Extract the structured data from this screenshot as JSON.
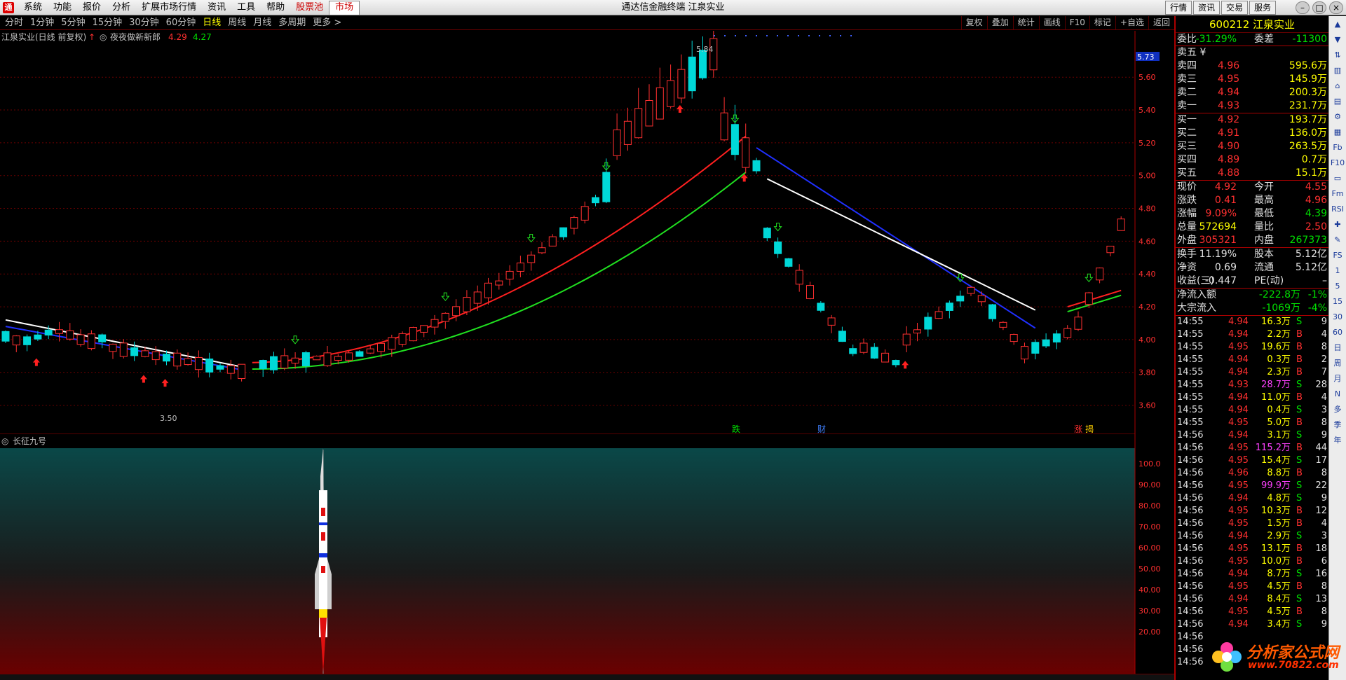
{
  "menubar": {
    "items": [
      "系统",
      "功能",
      "报价",
      "分析",
      "扩展市场行情",
      "资讯",
      "工具",
      "帮助"
    ],
    "stock_pool": "股票池",
    "market": "市场",
    "title": "通达信金融终端 江泉实业",
    "right_buttons": [
      "行情",
      "资讯",
      "交易",
      "服务"
    ]
  },
  "periods": {
    "items": [
      "分时",
      "1分钟",
      "5分钟",
      "15分钟",
      "30分钟",
      "60分钟",
      "日线",
      "周线",
      "月线",
      "多周期",
      "更多 >"
    ],
    "selected": "日线"
  },
  "chart_buttons": [
    "复权",
    "叠加",
    "统计",
    "画线",
    "F10",
    "标记",
    "+自选",
    "返回"
  ],
  "chart": {
    "title": "江泉实业(日线 前复权)",
    "indicator_name": "夜夜做新新郎",
    "ind_val1": "4.29",
    "ind_val2": "4.27",
    "y_labels": [
      "5.73",
      "5.60",
      "5.40",
      "5.20",
      "5.00",
      "4.80",
      "4.60",
      "4.40",
      "4.20",
      "4.00",
      "3.80",
      "3.60"
    ],
    "current_price_tag": "5.73",
    "high_label": "5.84",
    "low_label": "3.50",
    "events": [
      "跌",
      "财",
      "涨",
      "揭"
    ],
    "colors": {
      "up": "#ff3030",
      "down": "#00d8d8",
      "ma_red": "#ff2020",
      "ma_green": "#20e020",
      "ma_white": "#ffffff",
      "ma_blue": "#2030ff",
      "grid": "#6a0000"
    }
  },
  "subchart": {
    "title": "长征九号",
    "y_labels": [
      "100.0",
      "90.00",
      "80.00",
      "70.00",
      "60.00",
      "50.00",
      "40.00",
      "30.00",
      "20.00"
    ]
  },
  "quote": {
    "code_name": "600212 江泉实业",
    "weibi_label": "委比",
    "weibi": "-31.29%",
    "weicha_label": "委差",
    "weicha": "-11300",
    "sell_header": "卖五 ¥",
    "sells": [
      [
        "卖四",
        "4.96",
        "595.6万"
      ],
      [
        "卖三",
        "4.95",
        "145.9万"
      ],
      [
        "卖二",
        "4.94",
        "200.3万"
      ],
      [
        "卖一",
        "4.93",
        "231.7万"
      ]
    ],
    "buys": [
      [
        "买一",
        "4.92",
        "193.7万"
      ],
      [
        "买二",
        "4.91",
        "136.0万"
      ],
      [
        "买三",
        "4.90",
        "263.5万"
      ],
      [
        "买四",
        "4.89",
        "0.7万"
      ],
      [
        "买五",
        "4.88",
        "15.1万"
      ]
    ],
    "stats": [
      [
        "现价",
        "4.92",
        "今开",
        "4.55"
      ],
      [
        "涨跌",
        "0.41",
        "最高",
        "4.96"
      ],
      [
        "涨幅",
        "9.09%",
        "最低",
        "4.39"
      ],
      [
        "总量",
        "572694",
        "量比",
        "2.50"
      ],
      [
        "外盘",
        "305321",
        "内盘",
        "267373"
      ]
    ],
    "stats2": [
      [
        "换手",
        "11.19%",
        "股本",
        "5.12亿"
      ],
      [
        "净资",
        "0.69",
        "流通",
        "5.12亿"
      ],
      [
        "收益(三)",
        "-0.447",
        "PE(动)",
        "–"
      ]
    ],
    "flows": [
      [
        "净流入额",
        "-222.8万",
        "-1%"
      ],
      [
        "大宗流入",
        "-1069万",
        "-4%"
      ]
    ],
    "ticks": [
      [
        "14:55",
        "4.94",
        "16.3万",
        "S",
        "9"
      ],
      [
        "14:55",
        "4.94",
        "2.2万",
        "B",
        "4"
      ],
      [
        "14:55",
        "4.95",
        "19.6万",
        "B",
        "8"
      ],
      [
        "14:55",
        "4.94",
        "0.3万",
        "B",
        "2"
      ],
      [
        "14:55",
        "4.94",
        "2.3万",
        "B",
        "7"
      ],
      [
        "14:55",
        "4.93",
        "28.7万",
        "S",
        "28"
      ],
      [
        "14:55",
        "4.94",
        "11.0万",
        "B",
        "4"
      ],
      [
        "14:55",
        "4.94",
        "0.4万",
        "S",
        "3"
      ],
      [
        "14:55",
        "4.95",
        "5.0万",
        "B",
        "8"
      ],
      [
        "14:56",
        "4.94",
        "3.1万",
        "S",
        "9"
      ],
      [
        "14:56",
        "4.95",
        "115.2万",
        "B",
        "44"
      ],
      [
        "14:56",
        "4.95",
        "15.4万",
        "S",
        "17"
      ],
      [
        "14:56",
        "4.96",
        "8.8万",
        "B",
        "8"
      ],
      [
        "14:56",
        "4.95",
        "99.9万",
        "S",
        "22"
      ],
      [
        "14:56",
        "4.94",
        "4.8万",
        "S",
        "9"
      ],
      [
        "14:56",
        "4.95",
        "10.3万",
        "B",
        "12"
      ],
      [
        "14:56",
        "4.95",
        "1.5万",
        "B",
        "4"
      ],
      [
        "14:56",
        "4.94",
        "2.9万",
        "S",
        "3"
      ],
      [
        "14:56",
        "4.95",
        "13.1万",
        "B",
        "18"
      ],
      [
        "14:56",
        "4.95",
        "10.0万",
        "B",
        "6"
      ],
      [
        "14:56",
        "4.94",
        "8.7万",
        "S",
        "16"
      ],
      [
        "14:56",
        "4.95",
        "4.5万",
        "B",
        "8"
      ],
      [
        "14:56",
        "4.94",
        "8.4万",
        "S",
        "13"
      ],
      [
        "14:56",
        "4.95",
        "4.5万",
        "B",
        "8"
      ],
      [
        "14:56",
        "4.94",
        "3.4万",
        "S",
        "9"
      ],
      [
        "14:56",
        "",
        "",
        "",
        ""
      ],
      [
        "14:56",
        "",
        "",
        "",
        ""
      ],
      [
        "14:56",
        "",
        "",
        "",
        ""
      ]
    ]
  },
  "side_tools": [
    "▲",
    "▼",
    "⇅",
    "▥",
    "⌂",
    "▤",
    "⚙",
    "▦",
    "Fb",
    "F10",
    "▭",
    "Fm",
    "RSI",
    "✚",
    "✎",
    "FS",
    "1",
    "5",
    "15",
    "30",
    "60",
    "日",
    "周",
    "月",
    "N",
    "多",
    "季",
    "年"
  ],
  "watermark": {
    "line1": "分析家公式网",
    "line2": "www.70822.com"
  }
}
